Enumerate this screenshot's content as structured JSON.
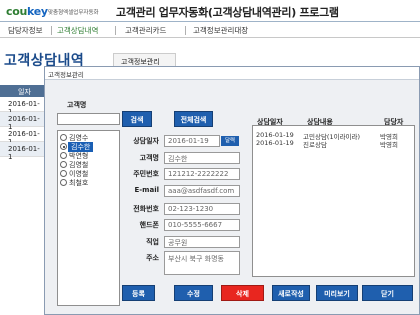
{
  "header": {
    "logo_part1": "cou",
    "logo_part2": "key",
    "logo_tagline": "맞춤형엑셀업무자동화",
    "app_title": "고객관리 업무자동화(고객상담내역관리) 프로그램"
  },
  "nav": {
    "items": [
      {
        "label": "담당자정보"
      },
      {
        "label": "고객상담내역"
      },
      {
        "label": "고객관리카드"
      },
      {
        "label": "고객정보관리대장"
      }
    ]
  },
  "background": {
    "section_title": "고객상담내역",
    "section_tab": "고객정보관리",
    "table_header": "일자",
    "rows": [
      "2016-01-1",
      "2016-01-1",
      "2016-01-1",
      "2016-01-1"
    ]
  },
  "dialog": {
    "title": "고객정보관리",
    "customer_list_label": "고객명",
    "search_input_value": "",
    "customers": [
      {
        "name": "김영수",
        "selected": false
      },
      {
        "name": "김수한",
        "selected": true
      },
      {
        "name": "박연형",
        "selected": false
      },
      {
        "name": "김영철",
        "selected": false
      },
      {
        "name": "이영철",
        "selected": false
      },
      {
        "name": "최철호",
        "selected": false
      }
    ],
    "search_button": "검색",
    "all_search_button": "전체검색",
    "form": {
      "consult_date_label": "상담일자",
      "consult_date_value": "2016-01-19",
      "calendar_button": "달력",
      "customer_name_label": "고객명",
      "customer_name_value": "김수한",
      "resident_number_label": "주민번호",
      "resident_number_value": "121212-2222222",
      "email_label": "E-mail",
      "email_value": "aaa@asdfasdf.com",
      "phone_label": "전화번호",
      "phone_value": "02-123-1230",
      "mobile_label": "핸드폰",
      "mobile_value": "010-5555-6667",
      "job_label": "직업",
      "job_value": "공무원",
      "address_label": "주소",
      "address_value": "부산시 북구 화명동"
    },
    "history": {
      "headers": {
        "date": "상담일자",
        "content": "상담내용",
        "manager": "담당자"
      },
      "rows": [
        {
          "date": "2016-01-19",
          "content": "고민상담(1이라이라)",
          "manager": "박영희"
        },
        {
          "date": "2016-01-19",
          "content": "진로상담",
          "manager": "박영희"
        }
      ]
    },
    "buttons": {
      "register": "등록",
      "edit": "수정",
      "delete": "삭제",
      "new_write": "새로작성",
      "preview": "미리보기",
      "close": "닫기"
    },
    "colors": {
      "button_blue": "#1f5fae",
      "button_red": "#e8261f",
      "selection": "#1a5fb4"
    }
  }
}
